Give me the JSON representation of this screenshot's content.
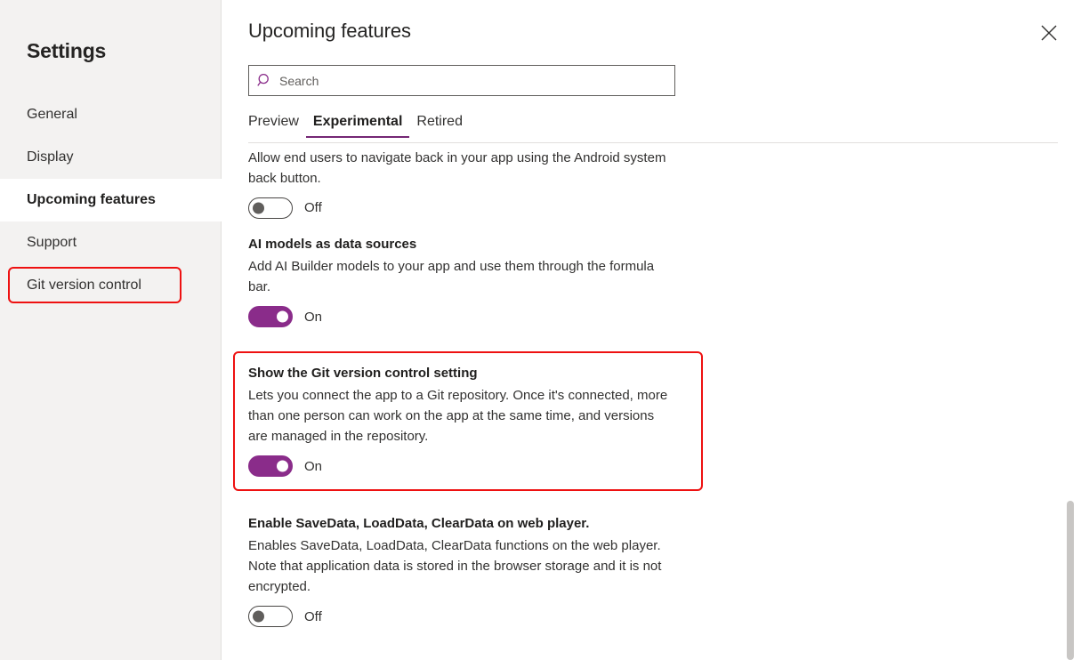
{
  "sidebar": {
    "title": "Settings",
    "items": [
      {
        "label": "General",
        "selected": false,
        "highlighted": false
      },
      {
        "label": "Display",
        "selected": false,
        "highlighted": false
      },
      {
        "label": "Upcoming features",
        "selected": true,
        "highlighted": false
      },
      {
        "label": "Support",
        "selected": false,
        "highlighted": false
      },
      {
        "label": "Git version control",
        "selected": false,
        "highlighted": true
      }
    ]
  },
  "panel": {
    "title": "Upcoming features",
    "close_icon": "close-icon",
    "search": {
      "icon": "search-icon",
      "placeholder": "Search",
      "value": ""
    },
    "tabs": [
      {
        "label": "Preview",
        "active": false
      },
      {
        "label": "Experimental",
        "active": true
      },
      {
        "label": "Retired",
        "active": false
      }
    ],
    "features": [
      {
        "title": "",
        "description": "Allow end users to navigate back in your app using the Android system back button.",
        "toggle_state": "Off",
        "toggle_on": false,
        "highlighted": false
      },
      {
        "title": "AI models as data sources",
        "description": "Add AI Builder models to your app and use them through the formula bar.",
        "toggle_state": "On",
        "toggle_on": true,
        "highlighted": false
      },
      {
        "title": "Show the Git version control setting",
        "description": "Lets you connect the app to a Git repository. Once it's connected, more than one person can work on the app at the same time, and versions are managed in the repository.",
        "toggle_state": "On",
        "toggle_on": true,
        "highlighted": true
      },
      {
        "title": "Enable SaveData, LoadData, ClearData on web player.",
        "description": "Enables SaveData, LoadData, ClearData functions on the web player. Note that application data is stored in the browser storage and it is not encrypted.",
        "toggle_state": "Off",
        "toggle_on": false,
        "highlighted": false
      }
    ]
  },
  "colors": {
    "accent_purple": "#8a2c8a",
    "tab_underline": "#742774",
    "highlight_red": "#ee1111",
    "sidebar_bg": "#f3f2f1",
    "scrollbar_thumb": "#c8c6c4"
  }
}
